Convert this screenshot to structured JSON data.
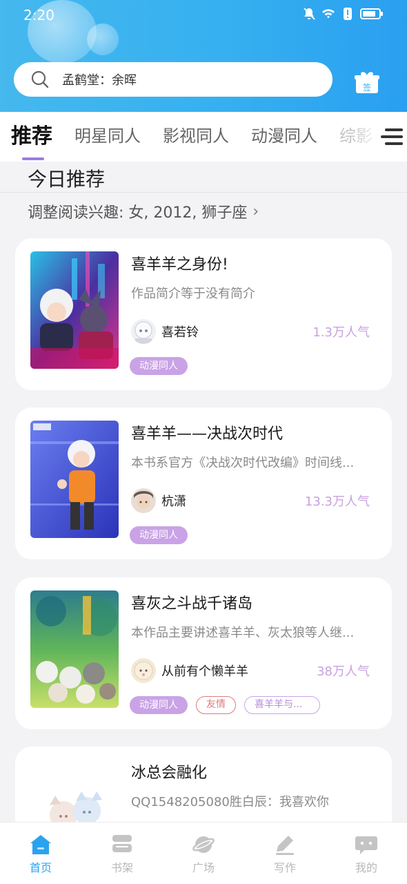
{
  "status_bar": {
    "time": "2:20"
  },
  "search": {
    "text": "孟鹤堂：余晖"
  },
  "gift_badge": "签",
  "tabs": [
    {
      "label": "推荐",
      "active": true
    },
    {
      "label": "明星同人"
    },
    {
      "label": "影视同人"
    },
    {
      "label": "动漫同人"
    },
    {
      "label": "综影"
    }
  ],
  "section": {
    "title": "今日推荐",
    "interest": "调整阅读兴趣: 女, 2012, 狮子座"
  },
  "books": [
    {
      "title": "喜羊羊之身份!",
      "desc": "作品简介等于没有简介",
      "author": "喜若铃",
      "popularity": "1.3万人气",
      "tags": [
        "动漫同人"
      ]
    },
    {
      "title": "喜羊羊——决战次时代",
      "desc": "本书系官方《决战次时代改编》时间线...",
      "author": "杭潇",
      "popularity": "13.3万人气",
      "tags": [
        "动漫同人"
      ]
    },
    {
      "title": "喜灰之斗战千诸岛",
      "desc": "本作品主要讲述喜羊羊、灰太狼等人继...",
      "author": "从前有个懒羊羊",
      "popularity": "38万人气",
      "tags": [
        "动漫同人",
        "友情",
        "喜羊羊与..."
      ]
    },
    {
      "title": "冰总会融化",
      "desc": "QQ1548205080胜白辰：我喜欢你"
    }
  ],
  "bottom_nav": [
    {
      "label": "首页",
      "icon": "home-icon",
      "active": true
    },
    {
      "label": "书架",
      "icon": "bookshelf-icon"
    },
    {
      "label": "广场",
      "icon": "planet-icon"
    },
    {
      "label": "写作",
      "icon": "write-icon"
    },
    {
      "label": "我的",
      "icon": "chat-bubble-icon"
    }
  ],
  "colors": {
    "header": "#36b0f0",
    "accent_purple": "#9b7be0",
    "tag_fill": "#c9a3e6",
    "popularity": "#c9a1e0",
    "nav_active": "#2aa3ee"
  }
}
